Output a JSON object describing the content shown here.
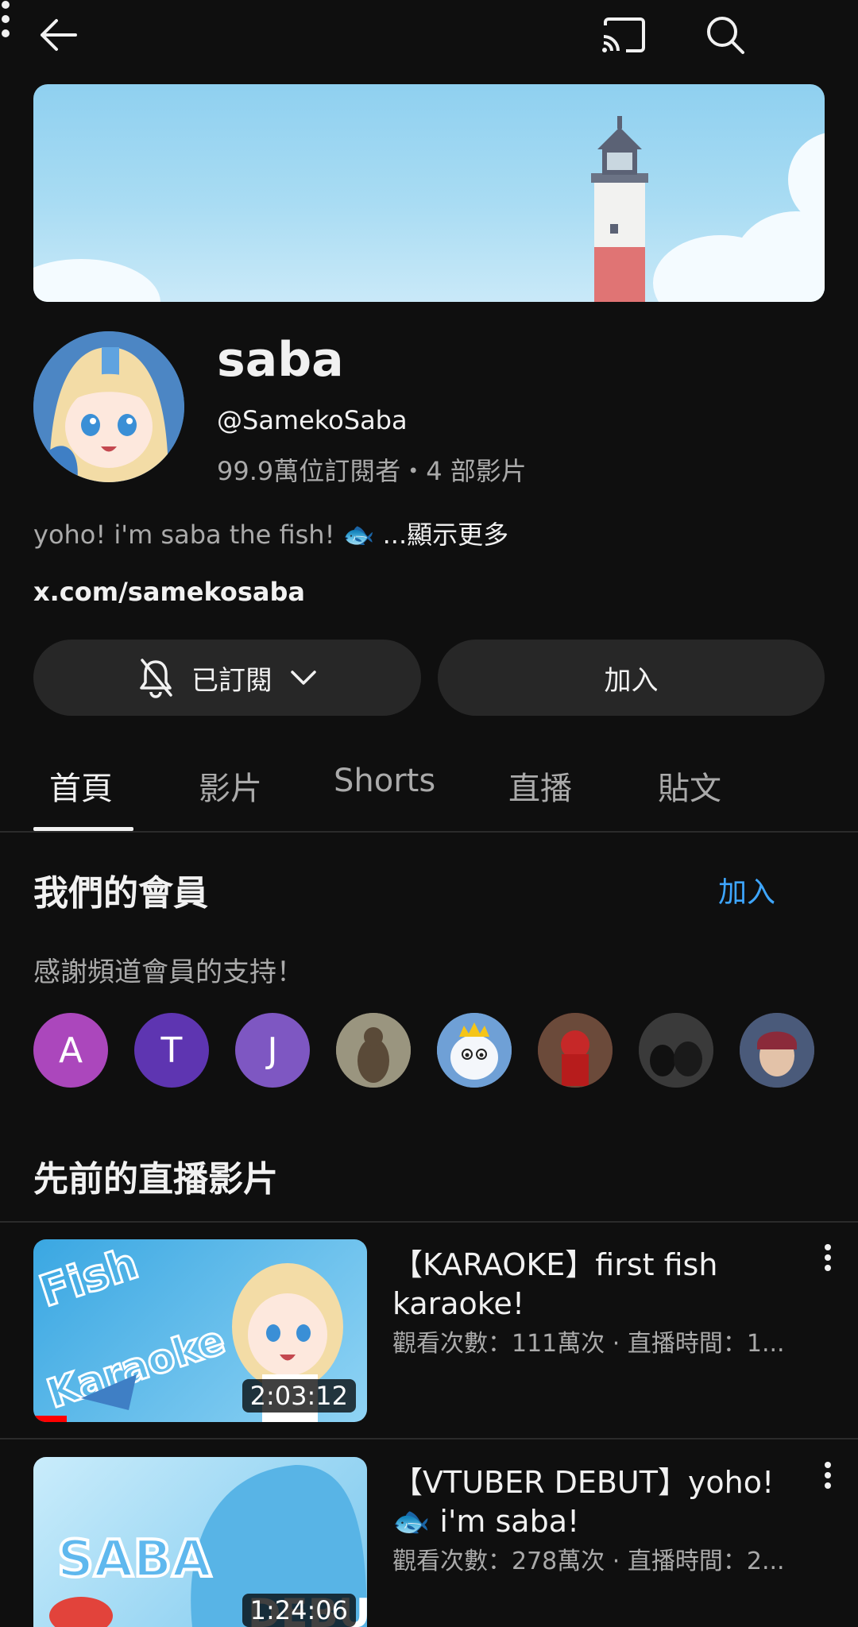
{
  "header": {
    "back_icon": "arrow-left-icon",
    "cast_icon": "cast-icon",
    "search_icon": "search-icon",
    "more_icon": "more-vert-icon"
  },
  "channel": {
    "name": "saba",
    "handle": "@SamekoSaba",
    "meta": "99.9萬位訂閱者・4 部影片",
    "description": "yoho! i'm saba the fish! 🐟 ",
    "description_more": "...顯示更多",
    "link": "x.com/samekosaba"
  },
  "actions": {
    "subscribed_label": "已訂閱",
    "join_label": "加入"
  },
  "tabs": [
    {
      "label": "首頁",
      "active": true
    },
    {
      "label": "影片",
      "active": false
    },
    {
      "label": "Shorts",
      "active": false
    },
    {
      "label": "直播",
      "active": false
    },
    {
      "label": "貼文",
      "active": false
    }
  ],
  "members_section": {
    "title": "我們的會員",
    "action": "加入",
    "subtitle": "感謝頻道會員的支持！",
    "members": [
      {
        "initial": "A",
        "color": "#ab47bc"
      },
      {
        "initial": "T",
        "color": "#5e35b1"
      },
      {
        "initial": "J",
        "color": "#7e57c2"
      },
      {
        "initial": "",
        "color": "#8a8674"
      },
      {
        "initial": "",
        "color": "#6fa0d6"
      },
      {
        "initial": "",
        "color": "#7a1e1e"
      },
      {
        "initial": "",
        "color": "#2a2a2a"
      },
      {
        "initial": "",
        "color": "#5a4f5e"
      }
    ]
  },
  "past_streams": {
    "title": "先前的直播影片",
    "videos": [
      {
        "title": "【KARAOKE】first fish karaoke!",
        "meta": "觀看次數：111萬次 · 直播時間：1...",
        "duration": "2:03:12",
        "progress": 0.1
      },
      {
        "title": "【VTUBER DEBUT】yoho! 🐟 i'm saba!",
        "meta": "觀看次數：278萬次 · 直播時間：2...",
        "duration": "1:24:06",
        "progress": 0
      }
    ]
  },
  "colors": {
    "background": "#0f0f0f",
    "accent_link": "#3ea6ff",
    "pill": "#272727"
  }
}
